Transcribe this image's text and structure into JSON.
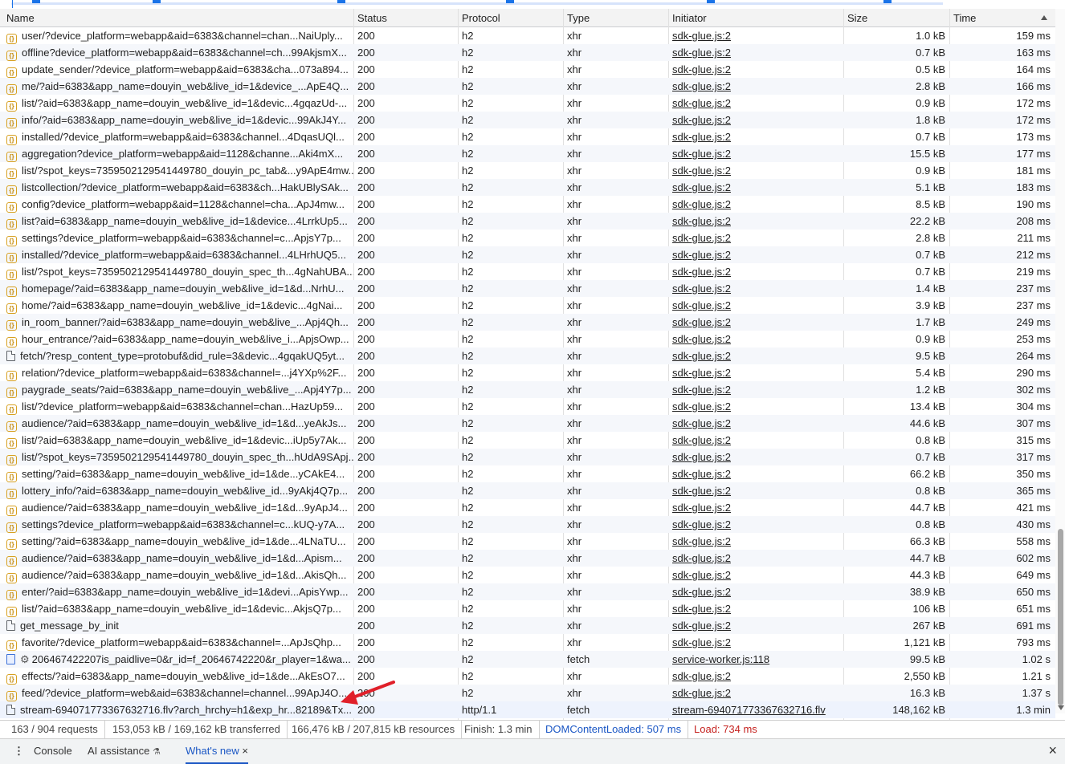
{
  "columns": [
    "Name",
    "Status",
    "Protocol",
    "Type",
    "Initiator",
    "Size",
    "Time"
  ],
  "rows": [
    {
      "icon": "json",
      "name": "user/?device_platform=webapp&aid=6383&channel=chan...NaiUply...",
      "status": "200",
      "protocol": "h2",
      "type": "xhr",
      "initiator": "sdk-glue.js:2",
      "size": "1.0 kB",
      "time": "159 ms"
    },
    {
      "icon": "json",
      "name": "offline?device_platform=webapp&aid=6383&channel=ch...99AkjsmX...",
      "status": "200",
      "protocol": "h2",
      "type": "xhr",
      "initiator": "sdk-glue.js:2",
      "size": "0.7 kB",
      "time": "163 ms"
    },
    {
      "icon": "json",
      "name": "update_sender/?device_platform=webapp&aid=6383&cha...073a894...",
      "status": "200",
      "protocol": "h2",
      "type": "xhr",
      "initiator": "sdk-glue.js:2",
      "size": "0.5 kB",
      "time": "164 ms"
    },
    {
      "icon": "json",
      "name": "me/?aid=6383&app_name=douyin_web&live_id=1&device_...ApE4Q...",
      "status": "200",
      "protocol": "h2",
      "type": "xhr",
      "initiator": "sdk-glue.js:2",
      "size": "2.8 kB",
      "time": "166 ms"
    },
    {
      "icon": "json",
      "name": "list/?aid=6383&app_name=douyin_web&live_id=1&devic...4gqazUd-...",
      "status": "200",
      "protocol": "h2",
      "type": "xhr",
      "initiator": "sdk-glue.js:2",
      "size": "0.9 kB",
      "time": "172 ms"
    },
    {
      "icon": "json",
      "name": "info/?aid=6383&app_name=douyin_web&live_id=1&devic...99AkJ4Y...",
      "status": "200",
      "protocol": "h2",
      "type": "xhr",
      "initiator": "sdk-glue.js:2",
      "size": "1.8 kB",
      "time": "172 ms"
    },
    {
      "icon": "json",
      "name": "installed/?device_platform=webapp&aid=6383&channel...4DqasUQl...",
      "status": "200",
      "protocol": "h2",
      "type": "xhr",
      "initiator": "sdk-glue.js:2",
      "size": "0.7 kB",
      "time": "173 ms"
    },
    {
      "icon": "json",
      "name": "aggregation?device_platform=webapp&aid=1128&channe...Aki4mX...",
      "status": "200",
      "protocol": "h2",
      "type": "xhr",
      "initiator": "sdk-glue.js:2",
      "size": "15.5 kB",
      "time": "177 ms"
    },
    {
      "icon": "json",
      "name": "list/?spot_keys=7359502129541449780_douyin_pc_tab&...y9ApE4mw...",
      "status": "200",
      "protocol": "h2",
      "type": "xhr",
      "initiator": "sdk-glue.js:2",
      "size": "0.9 kB",
      "time": "181 ms"
    },
    {
      "icon": "json",
      "name": "listcollection/?device_platform=webapp&aid=6383&ch...HakUBlySAk...",
      "status": "200",
      "protocol": "h2",
      "type": "xhr",
      "initiator": "sdk-glue.js:2",
      "size": "5.1 kB",
      "time": "183 ms"
    },
    {
      "icon": "json",
      "name": "config?device_platform=webapp&aid=1128&channel=cha...ApJ4mw...",
      "status": "200",
      "protocol": "h2",
      "type": "xhr",
      "initiator": "sdk-glue.js:2",
      "size": "8.5 kB",
      "time": "190 ms"
    },
    {
      "icon": "json",
      "name": "list?aid=6383&app_name=douyin_web&live_id=1&device...4LrrkUp5...",
      "status": "200",
      "protocol": "h2",
      "type": "xhr",
      "initiator": "sdk-glue.js:2",
      "size": "22.2 kB",
      "time": "208 ms"
    },
    {
      "icon": "json",
      "name": "settings?device_platform=webapp&aid=6383&channel=c...ApjsY7p...",
      "status": "200",
      "protocol": "h2",
      "type": "xhr",
      "initiator": "sdk-glue.js:2",
      "size": "2.8 kB",
      "time": "211 ms"
    },
    {
      "icon": "json",
      "name": "installed/?device_platform=webapp&aid=6383&channel...4LHrhUQ5...",
      "status": "200",
      "protocol": "h2",
      "type": "xhr",
      "initiator": "sdk-glue.js:2",
      "size": "0.7 kB",
      "time": "212 ms"
    },
    {
      "icon": "json",
      "name": "list/?spot_keys=7359502129541449780_douyin_spec_th...4gNahUBA...",
      "status": "200",
      "protocol": "h2",
      "type": "xhr",
      "initiator": "sdk-glue.js:2",
      "size": "0.7 kB",
      "time": "219 ms"
    },
    {
      "icon": "json",
      "name": "homepage/?aid=6383&app_name=douyin_web&live_id=1&d...NrhU...",
      "status": "200",
      "protocol": "h2",
      "type": "xhr",
      "initiator": "sdk-glue.js:2",
      "size": "1.4 kB",
      "time": "237 ms"
    },
    {
      "icon": "json",
      "name": "home/?aid=6383&app_name=douyin_web&live_id=1&devic...4gNai...",
      "status": "200",
      "protocol": "h2",
      "type": "xhr",
      "initiator": "sdk-glue.js:2",
      "size": "3.9 kB",
      "time": "237 ms"
    },
    {
      "icon": "json",
      "name": "in_room_banner/?aid=6383&app_name=douyin_web&live_...Apj4Qh...",
      "status": "200",
      "protocol": "h2",
      "type": "xhr",
      "initiator": "sdk-glue.js:2",
      "size": "1.7 kB",
      "time": "249 ms"
    },
    {
      "icon": "json",
      "name": "hour_entrance/?aid=6383&app_name=douyin_web&live_i...ApjsOwp...",
      "status": "200",
      "protocol": "h2",
      "type": "xhr",
      "initiator": "sdk-glue.js:2",
      "size": "0.9 kB",
      "time": "253 ms"
    },
    {
      "icon": "doc",
      "name": "fetch/?resp_content_type=protobuf&did_rule=3&devic...4gqakUQ5yt...",
      "status": "200",
      "protocol": "h2",
      "type": "xhr",
      "initiator": "sdk-glue.js:2",
      "size": "9.5 kB",
      "time": "264 ms"
    },
    {
      "icon": "json",
      "name": "relation/?device_platform=webapp&aid=6383&channel=...j4YXp%2F...",
      "status": "200",
      "protocol": "h2",
      "type": "xhr",
      "initiator": "sdk-glue.js:2",
      "size": "5.4 kB",
      "time": "290 ms"
    },
    {
      "icon": "json",
      "name": "paygrade_seats/?aid=6383&app_name=douyin_web&live_...Apj4Y7p...",
      "status": "200",
      "protocol": "h2",
      "type": "xhr",
      "initiator": "sdk-glue.js:2",
      "size": "1.2 kB",
      "time": "302 ms"
    },
    {
      "icon": "json",
      "name": "list/?device_platform=webapp&aid=6383&channel=chan...HazUp59...",
      "status": "200",
      "protocol": "h2",
      "type": "xhr",
      "initiator": "sdk-glue.js:2",
      "size": "13.4 kB",
      "time": "304 ms"
    },
    {
      "icon": "json",
      "name": "audience/?aid=6383&app_name=douyin_web&live_id=1&d...yeAkJs...",
      "status": "200",
      "protocol": "h2",
      "type": "xhr",
      "initiator": "sdk-glue.js:2",
      "size": "44.6 kB",
      "time": "307 ms"
    },
    {
      "icon": "json",
      "name": "list/?aid=6383&app_name=douyin_web&live_id=1&devic...iUp5y7Ak...",
      "status": "200",
      "protocol": "h2",
      "type": "xhr",
      "initiator": "sdk-glue.js:2",
      "size": "0.8 kB",
      "time": "315 ms"
    },
    {
      "icon": "json",
      "name": "list/?spot_keys=7359502129541449780_douyin_spec_th...hUdA9SApj...",
      "status": "200",
      "protocol": "h2",
      "type": "xhr",
      "initiator": "sdk-glue.js:2",
      "size": "0.7 kB",
      "time": "317 ms"
    },
    {
      "icon": "json",
      "name": "setting/?aid=6383&app_name=douyin_web&live_id=1&de...yCAkE4...",
      "status": "200",
      "protocol": "h2",
      "type": "xhr",
      "initiator": "sdk-glue.js:2",
      "size": "66.2 kB",
      "time": "350 ms"
    },
    {
      "icon": "json",
      "name": "lottery_info/?aid=6383&app_name=douyin_web&live_id...9yAkj4Q7p...",
      "status": "200",
      "protocol": "h2",
      "type": "xhr",
      "initiator": "sdk-glue.js:2",
      "size": "0.8 kB",
      "time": "365 ms"
    },
    {
      "icon": "json",
      "name": "audience/?aid=6383&app_name=douyin_web&live_id=1&d...9yApJ4...",
      "status": "200",
      "protocol": "h2",
      "type": "xhr",
      "initiator": "sdk-glue.js:2",
      "size": "44.7 kB",
      "time": "421 ms"
    },
    {
      "icon": "json",
      "name": "settings?device_platform=webapp&aid=6383&channel=c...kUQ-y7A...",
      "status": "200",
      "protocol": "h2",
      "type": "xhr",
      "initiator": "sdk-glue.js:2",
      "size": "0.8 kB",
      "time": "430 ms"
    },
    {
      "icon": "json",
      "name": "setting/?aid=6383&app_name=douyin_web&live_id=1&de...4LNaTU...",
      "status": "200",
      "protocol": "h2",
      "type": "xhr",
      "initiator": "sdk-glue.js:2",
      "size": "66.3 kB",
      "time": "558 ms"
    },
    {
      "icon": "json",
      "name": "audience/?aid=6383&app_name=douyin_web&live_id=1&d...Apism...",
      "status": "200",
      "protocol": "h2",
      "type": "xhr",
      "initiator": "sdk-glue.js:2",
      "size": "44.7 kB",
      "time": "602 ms"
    },
    {
      "icon": "json",
      "name": "audience/?aid=6383&app_name=douyin_web&live_id=1&d...AkisQh...",
      "status": "200",
      "protocol": "h2",
      "type": "xhr",
      "initiator": "sdk-glue.js:2",
      "size": "44.3 kB",
      "time": "649 ms"
    },
    {
      "icon": "json",
      "name": "enter/?aid=6383&app_name=douyin_web&live_id=1&devi...ApisYwp...",
      "status": "200",
      "protocol": "h2",
      "type": "xhr",
      "initiator": "sdk-glue.js:2",
      "size": "38.9 kB",
      "time": "650 ms"
    },
    {
      "icon": "json",
      "name": "list/?aid=6383&app_name=douyin_web&live_id=1&devic...AkjsQ7p...",
      "status": "200",
      "protocol": "h2",
      "type": "xhr",
      "initiator": "sdk-glue.js:2",
      "size": "106 kB",
      "time": "651 ms"
    },
    {
      "icon": "doc",
      "name": "get_message_by_init",
      "status": "200",
      "protocol": "h2",
      "type": "xhr",
      "initiator": "sdk-glue.js:2",
      "size": "267 kB",
      "time": "691 ms"
    },
    {
      "icon": "json",
      "name": "favorite/?device_platform=webapp&aid=6383&channel=...ApJsQhp...",
      "status": "200",
      "protocol": "h2",
      "type": "xhr",
      "initiator": "sdk-glue.js:2",
      "size": "1,121 kB",
      "time": "793 ms"
    },
    {
      "icon": "page",
      "gear": "⚙",
      "name": "206467422207is_paidlive=0&r_id=f_20646742220&r_player=1&wa...",
      "status": "200",
      "protocol": "h2",
      "type": "fetch",
      "initiator": "service-worker.js:118",
      "size": "99.5 kB",
      "time": "1.02 s"
    },
    {
      "icon": "json",
      "name": "effects/?aid=6383&app_name=douyin_web&live_id=1&de...AkEsO7...",
      "status": "200",
      "protocol": "h2",
      "type": "xhr",
      "initiator": "sdk-glue.js:2",
      "size": "2,550 kB",
      "time": "1.21 s"
    },
    {
      "icon": "json",
      "name": "feed/?device_platform=web&aid=6383&channel=channel...99ApJ4O...",
      "status": "200",
      "protocol": "h2",
      "type": "xhr",
      "initiator": "sdk-glue.js:2",
      "size": "16.3 kB",
      "time": "1.37 s"
    },
    {
      "icon": "doc",
      "name": "stream-694071773367632716.flv?arch_hrchy=h1&exp_hr...82189&Tx...",
      "status": "200",
      "protocol": "http/1.1",
      "type": "fetch",
      "initiator": "stream-694071773367632716.flv",
      "size": "148,162 kB",
      "time": "1.3 min"
    }
  ],
  "summary": {
    "requests": "163 / 904 requests",
    "transferred": "153,053 kB / 169,162 kB transferred",
    "resources": "166,476 kB / 207,815 kB resources",
    "finish": "Finish: 1.3 min",
    "dcl": "DOMContentLoaded: 507 ms",
    "load": "Load: 734 ms"
  },
  "drawer": {
    "tabs": [
      "Console",
      "AI assistance",
      "What's new"
    ],
    "active": "What's new",
    "ai_icon": "flask-icon",
    "close": "×"
  },
  "colors": {
    "accent": "#1a73e8",
    "load_red": "#c5221f",
    "dcl_blue": "#1a56c4",
    "annotation_arrow": "#e0202a"
  }
}
